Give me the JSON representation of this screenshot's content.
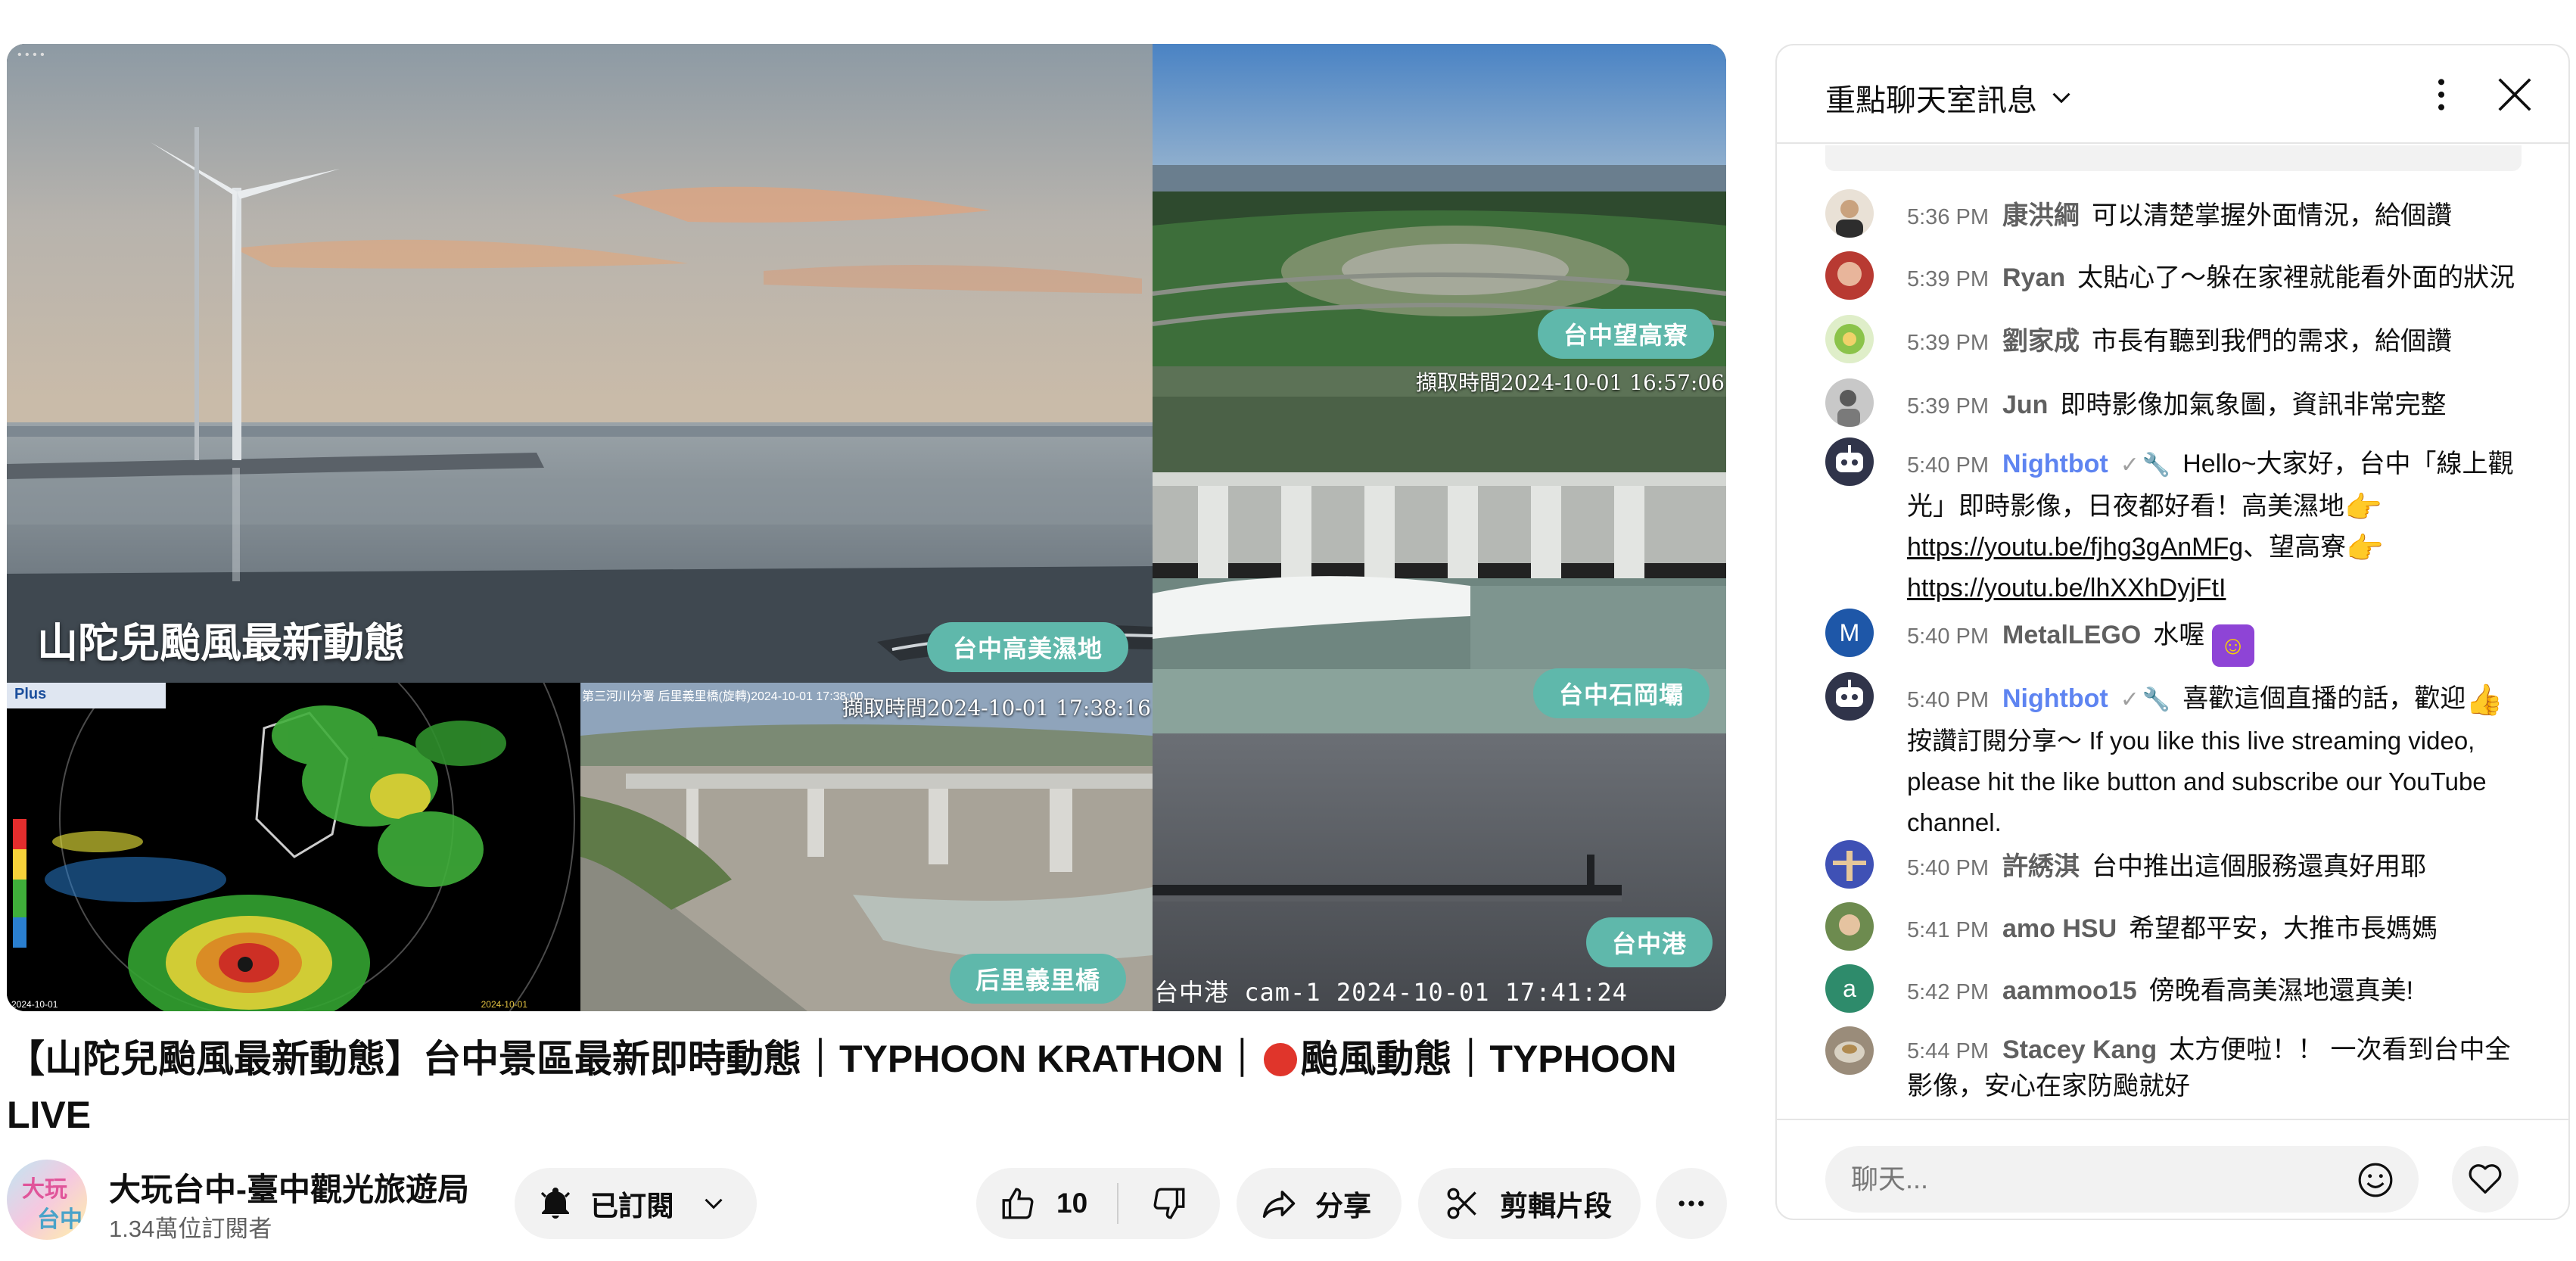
{
  "video": {
    "overlay_headline": "山陀兒颱風最新動態",
    "cams": {
      "main_label": "台中高美濕地",
      "wanggao_label": "台中望高寮",
      "shigang_label": "台中石岡壩",
      "shigang_stamp": "擷取時間2024-10-01 16:57:06",
      "houli_label": "后里義里橋",
      "houli_caption": "第三河川分署  后里義里橋(旋轉)2024-10-01 17:38:00",
      "houli_stamp": "擷取時間2024-10-01 17:38:16",
      "harbor_label": "台中港",
      "harbor_stamp": "台中港 cam-1 2024-10-01 17:41:24",
      "radar_brand": "Plus",
      "radar_date_left": "2024-10-01",
      "radar_date_right": "2024-10-01"
    }
  },
  "title": {
    "part1": "【山陀兒颱風最新動態】台中景區最新即時動態｜TYPHOON KRATHON｜",
    "part2": "颱風動態｜TYPHOON LIVE"
  },
  "channel": {
    "avatar_text_1": "大玩",
    "avatar_text_2": "台中",
    "name": "大玩台中-臺中觀光旅遊局",
    "subscribers": "1.34萬位訂閱者"
  },
  "actions": {
    "subscribed_label": "已訂閱",
    "like_count": "10",
    "share_label": "分享",
    "clip_label": "剪輯片段"
  },
  "chat": {
    "header_title": "重點聊天室訊息",
    "input_placeholder": "聊天...",
    "messages": [
      {
        "time": "5:36 PM",
        "author": "康洪綱",
        "text": "可以清楚掌握外面情況，給個讚",
        "avatar_color": "#c9a27e"
      },
      {
        "time": "5:39 PM",
        "author": "Ryan",
        "text": "太貼心了～躲在家裡就能看外面的狀況",
        "avatar_color": "#c0392b"
      },
      {
        "time": "5:39 PM",
        "author": "劉家成",
        "text": "市長有聽到我們的需求，給個讚",
        "avatar_color": "#8bc34a"
      },
      {
        "time": "5:39 PM",
        "author": "Jun",
        "text": "即時影像加氣象圖，資訊非常完整",
        "avatar_color": "#9e9e9e"
      },
      {
        "time": "5:40 PM",
        "author": "Nightbot",
        "text_a": "Hello~大家好，台中「線上觀光」即時影像，日夜都好看！高美濕地",
        "link_a": "https://youtu.be/fjhg3gAnMFg",
        "text_b": "、望高寮",
        "link_b": "https://youtu.be/lhXXhDyjFtI",
        "avatar_color": "#30344a"
      },
      {
        "time": "5:40 PM",
        "author": "MetalLEGO",
        "text": "水喔",
        "avatar_letter": "M",
        "avatar_color": "#1e57a8"
      },
      {
        "time": "5:40 PM",
        "author": "Nightbot",
        "text_a": "喜歡這個直播的話，歡迎",
        "text_b": "按讚訂閱分享～",
        "text_en": "If you like this live streaming video, please hit the like button and subscribe our YouTube channel.",
        "avatar_color": "#30344a"
      },
      {
        "time": "5:40 PM",
        "author": "許綉淇",
        "text": "台中推出這個服務還真好用耶",
        "avatar_color": "#3f51b5"
      },
      {
        "time": "5:41 PM",
        "author": "amo HSU",
        "text": "希望都平安，大推市長媽媽",
        "avatar_color": "#6d8b4f"
      },
      {
        "time": "5:42 PM",
        "author": "aammoo15",
        "text": "傍晚看高美濕地還真美!",
        "avatar_letter": "a",
        "avatar_color": "#2e8b6b"
      },
      {
        "time": "5:44 PM",
        "author": "Stacey Kang",
        "text": "太方便啦！！ 一次看到台中全影像，安心在家防颱就好",
        "avatar_color": "#9a8c7a"
      }
    ]
  },
  "colors": {
    "pill": "#5fb8ab",
    "moderator": "#5e84f1",
    "live_dot": "#e0352b"
  },
  "icons": [
    "bell-icon",
    "chevron-down-icon",
    "thumbs-up-icon",
    "thumbs-down-icon",
    "share-arrow-icon",
    "scissors-icon",
    "more-horizontal-icon",
    "kebab-vertical-icon",
    "close-icon",
    "smiley-icon",
    "heart-icon",
    "wrench-icon",
    "verified-check-icon"
  ]
}
